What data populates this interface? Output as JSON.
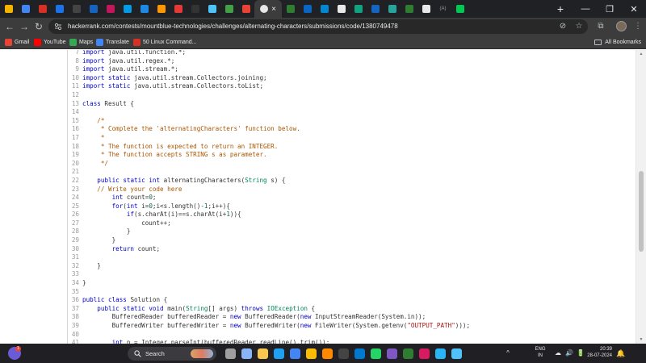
{
  "browser": {
    "tabs": [
      {
        "icon": "google-drive-icon",
        "color": "#f4b400"
      },
      {
        "icon": "drive-icon",
        "color": "#4285f4"
      },
      {
        "icon": "red-circle-icon",
        "color": "#d93025"
      },
      {
        "icon": "docs-icon",
        "color": "#1a73e8"
      },
      {
        "icon": "app-icon",
        "color": "#444444"
      },
      {
        "icon": "blue-b-icon",
        "color": "#1565c0"
      },
      {
        "icon": "arrow-icon",
        "color": "#c2185b"
      },
      {
        "icon": "s-icon",
        "color": "#039be5"
      },
      {
        "icon": "link-icon",
        "color": "#1e88e5"
      },
      {
        "icon": "orange-icon",
        "color": "#ff9800"
      },
      {
        "icon": "red-tag-icon",
        "color": "#e53935"
      },
      {
        "icon": "dark-icon",
        "color": "#333333"
      },
      {
        "icon": "star-icon",
        "color": "#4fc3f7"
      },
      {
        "icon": "green-icon",
        "color": "#43a047"
      },
      {
        "icon": "gmail-icon",
        "color": "#ea4335"
      },
      {
        "icon": "hackerrank-icon",
        "color": "#e8e8e8",
        "active": true
      },
      {
        "icon": "g-icon",
        "color": "#2e7d32"
      },
      {
        "icon": "linkedin-icon",
        "color": "#0a66c2"
      },
      {
        "icon": "cloud-icon",
        "color": "#0288d1"
      },
      {
        "icon": "github-icon",
        "color": "#e8e8e8"
      },
      {
        "icon": "chatgpt-icon",
        "color": "#10a37f"
      },
      {
        "icon": "mail-icon",
        "color": "#1565c0"
      },
      {
        "icon": "diamond-icon",
        "color": "#26a69a"
      },
      {
        "icon": "green-bar-icon",
        "color": "#2e7d32"
      },
      {
        "icon": "github-icon",
        "color": "#e8e8e8"
      },
      {
        "icon": "bracket-icon",
        "color": "#9e9e9e",
        "text": "(A)"
      },
      {
        "icon": "dot-icon",
        "color": "#00c853"
      }
    ],
    "active_tab_close": "×",
    "new_tab": "+",
    "window_controls": [
      "—",
      "❐",
      "✕"
    ],
    "url": "hackerrank.com/contests/mountblue-technologies/challenges/alternating-characters/submissions/code/1380749478",
    "bookmarks": [
      {
        "label": "Gmail",
        "color": "#ea4335"
      },
      {
        "label": "YouTube",
        "color": "#ff0000"
      },
      {
        "label": "Maps",
        "color": "#34a853"
      },
      {
        "label": "Translate",
        "color": "#4285f4"
      },
      {
        "label": "50 Linux Command...",
        "color": "#d93025"
      }
    ],
    "all_bookmarks": "All Bookmarks"
  },
  "code": {
    "lines": [
      {
        "n": "7",
        "text": "import java.util.function.*;"
      },
      {
        "n": "8",
        "text": "import java.util.regex.*;"
      },
      {
        "n": "9",
        "text": "import java.util.stream.*;"
      },
      {
        "n": "10",
        "text": "import static java.util.stream.Collectors.joining;"
      },
      {
        "n": "11",
        "text": "import static java.util.stream.Collectors.toList;"
      },
      {
        "n": "12",
        "text": ""
      },
      {
        "n": "13",
        "text": "class Result {"
      },
      {
        "n": "14",
        "text": ""
      },
      {
        "n": "15",
        "text": "    /*"
      },
      {
        "n": "16",
        "text": "     * Complete the 'alternatingCharacters' function below."
      },
      {
        "n": "17",
        "text": "     *"
      },
      {
        "n": "18",
        "text": "     * The function is expected to return an INTEGER."
      },
      {
        "n": "19",
        "text": "     * The function accepts STRING s as parameter."
      },
      {
        "n": "20",
        "text": "     */"
      },
      {
        "n": "21",
        "text": ""
      },
      {
        "n": "22",
        "text": "    public static int alternatingCharacters(String s) {"
      },
      {
        "n": "23",
        "text": "    // Write your code here"
      },
      {
        "n": "24",
        "text": "        int count=0;"
      },
      {
        "n": "25",
        "text": "        for(int i=0;i<s.length()-1;i++){"
      },
      {
        "n": "26",
        "text": "            if(s.charAt(i)==s.charAt(i+1)){"
      },
      {
        "n": "27",
        "text": "                count++;"
      },
      {
        "n": "28",
        "text": "            }"
      },
      {
        "n": "29",
        "text": "        }"
      },
      {
        "n": "30",
        "text": "        return count;"
      },
      {
        "n": "31",
        "text": ""
      },
      {
        "n": "32",
        "text": "    }"
      },
      {
        "n": "33",
        "text": ""
      },
      {
        "n": "34",
        "text": "}"
      },
      {
        "n": "35",
        "text": ""
      },
      {
        "n": "36",
        "text": "public class Solution {"
      },
      {
        "n": "37",
        "text": "    public static void main(String[] args) throws IOException {"
      },
      {
        "n": "38",
        "text": "        BufferedReader bufferedReader = new BufferedReader(new InputStreamReader(System.in));"
      },
      {
        "n": "39",
        "text": "        BufferedWriter bufferedWriter = new BufferedWriter(new FileWriter(System.getenv(\"OUTPUT_PATH\")));"
      },
      {
        "n": "40",
        "text": ""
      },
      {
        "n": "41",
        "text": "        int n = Integer.parseInt(bufferedReader.readLine().trim());"
      }
    ]
  },
  "taskbar": {
    "weather_badge": "1",
    "search_label": "Search",
    "apps": [
      {
        "icon": "task-view-icon",
        "color": "#9e9e9e"
      },
      {
        "icon": "widgets-icon",
        "color": "#8ab4f8"
      },
      {
        "icon": "file-explorer-icon",
        "color": "#f9c74f"
      },
      {
        "icon": "edge-icon",
        "color": "#1ea1f1"
      },
      {
        "icon": "store-icon",
        "color": "#4285f4"
      },
      {
        "icon": "chrome-icon",
        "color": "#fbbc05"
      },
      {
        "icon": "vlc-icon",
        "color": "#ff8800"
      },
      {
        "icon": "terminal-icon",
        "color": "#444444"
      },
      {
        "icon": "vscode-icon",
        "color": "#007acc"
      },
      {
        "icon": "whatsapp-icon",
        "color": "#25d366"
      },
      {
        "icon": "visual-studio-icon",
        "color": "#7e57c2"
      },
      {
        "icon": "app-icon",
        "color": "#2e7d32"
      },
      {
        "icon": "intellij-icon",
        "color": "#d81b60"
      },
      {
        "icon": "telegram-icon",
        "color": "#29b6f6"
      },
      {
        "icon": "notes-icon",
        "color": "#4fc3f7"
      }
    ],
    "tray": [
      "^",
      "☁",
      "🔊",
      "🔋"
    ],
    "lang_top": "ENG",
    "lang_bottom": "IN",
    "time": "20:39",
    "date": "28-07-2024"
  }
}
